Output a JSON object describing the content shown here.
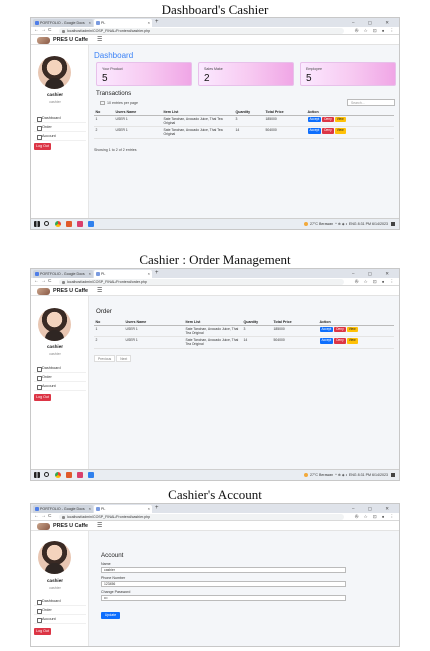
{
  "captions": [
    "Dashboard's Cashier",
    "Cashier : Order Management",
    "Cashier's Account"
  ],
  "browser": {
    "tab1_title": "PORTFOLIO - Google Docs",
    "tab2_title": "PL",
    "new_tab": "+",
    "window_controls": "– ▢ ✕",
    "nav_back": "←",
    "nav_forward": "→",
    "nav_reload": "C",
    "nav_home": "⌂",
    "ext_icons": "✇ ☆ ⊡ ●  ⋮",
    "url_dashboard": "localhost/admin/COSP_FINAL/Frontend/cashier.php",
    "url_orders": "localhost/admin/COSP_FINAL/Frontend/order.php",
    "url_account": "localhost/admin/COSP_FINAL/Frontend/cashier.php"
  },
  "app": {
    "brand": "PRES U Caffe",
    "menu_toggle": "☰",
    "user_name": "cashier",
    "user_role": "cashier",
    "menu": [
      "Dashboard",
      "Order",
      "Account"
    ],
    "logout": "Log Out"
  },
  "dashboard": {
    "title": "Dashboard",
    "cards": [
      {
        "label": "Your Product",
        "value": "5"
      },
      {
        "label": "Sales Make",
        "value": "2"
      },
      {
        "label": "Employee",
        "value": "5"
      }
    ],
    "transactions_title": "Transactions",
    "entries_label": "entries per page",
    "entries_value": "10",
    "search_placeholder": "Search...",
    "showing": "Showing 1 to 2 of 2 entries"
  },
  "orders": {
    "title": "Order",
    "previous": "Previous",
    "next": "Next"
  },
  "table": {
    "headers": [
      "No",
      "Users Name",
      "Item List",
      "Quantity",
      "Total Price",
      "Action"
    ],
    "rows": [
      {
        "no": "1",
        "user": "USER 1",
        "items": "Sate Tanchan, Avocado Juice, Thai Tea Original",
        "qty": "3",
        "total": "185000"
      },
      {
        "no": "2",
        "user": "USER 1",
        "items": "Sate Tanchan, Avocado Juice, Thai Tea Original",
        "qty": "14",
        "total": "504000"
      }
    ],
    "actions": [
      "Accept",
      "Deny",
      "View"
    ]
  },
  "account": {
    "title": "Account",
    "name_label": "Name",
    "name_value": "cashier",
    "phone_label": "Phone Number",
    "phone_value": "123456",
    "password_label": "Change Password",
    "password_value": "•••",
    "update": "Update"
  },
  "taskbar": {
    "weather": "27°C Berawan",
    "tray": "ENG",
    "time_dashboard": "8:31 PM",
    "date_dashboard": "6/14/2023",
    "time_orders": "8:31 PM",
    "date_orders": "6/14/2023",
    "tray_icons": "^ ⊕ ◈ ◐"
  }
}
